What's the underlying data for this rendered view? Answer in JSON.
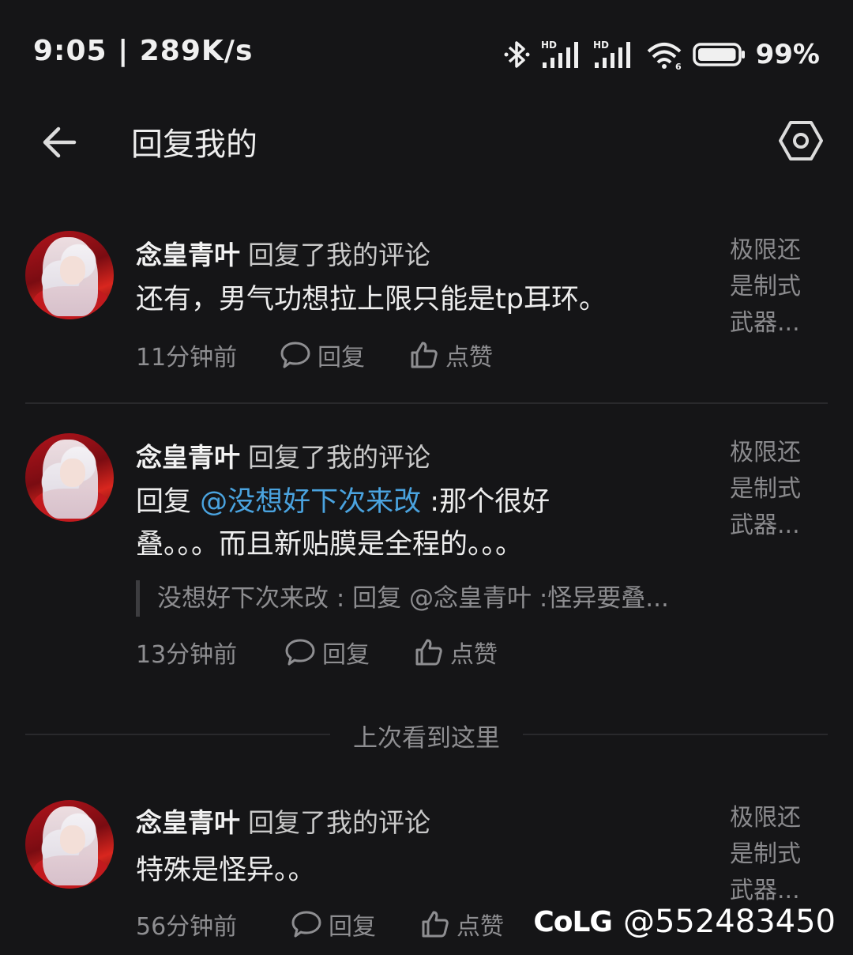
{
  "status_bar": {
    "time_speed": "9:05 | 289K/s",
    "icons": [
      "bluetooth-icon",
      "hd-signal-icon",
      "hd-signal-icon",
      "wifi-icon",
      "battery-icon"
    ],
    "signal_label_1": "HD",
    "signal_label_2": "HD",
    "wifi_label": "6",
    "battery_level": 0.99,
    "battery": "99%"
  },
  "app_bar": {
    "title": "回复我的",
    "back_icon": "arrow-left-icon",
    "settings_icon": "settings-hexagon-icon"
  },
  "items": [
    {
      "user": "念皇青叶",
      "action": "回复了我的评论",
      "content_prefix": "",
      "mention": "",
      "content": "还有，男气功想拉上限只能是tp耳环。",
      "quote": "",
      "time": "11分钟前",
      "reply_label": "回复",
      "like_label": "点赞",
      "preview": "极限还是制式武器..."
    },
    {
      "user": "念皇青叶",
      "action": "回复了我的评论",
      "content_prefix": "回复 ",
      "mention": "@没想好下次来改",
      "content": " :那个很好叠。。。而且新贴膜是全程的。。。",
      "quote": "没想好下次来改 : 回复 @念皇青叶 :怪异要叠...",
      "time": "13分钟前",
      "reply_label": "回复",
      "like_label": "点赞",
      "preview": "极限还是制式武器..."
    },
    {
      "user": "念皇青叶",
      "action": "回复了我的评论",
      "content_prefix": "",
      "mention": "",
      "content": "特殊是怪异。。",
      "quote": "",
      "time": "56分钟前",
      "reply_label": "回复",
      "like_label": "点赞",
      "preview": "极限还是制式武器..."
    }
  ],
  "last_seen_label": "上次看到这里",
  "watermark": {
    "logo": "CoLG",
    "handle": "@552483450"
  },
  "colors": {
    "background": "#151517",
    "mention": "#4aa3df",
    "secondary_text": "#8e8e91"
  }
}
